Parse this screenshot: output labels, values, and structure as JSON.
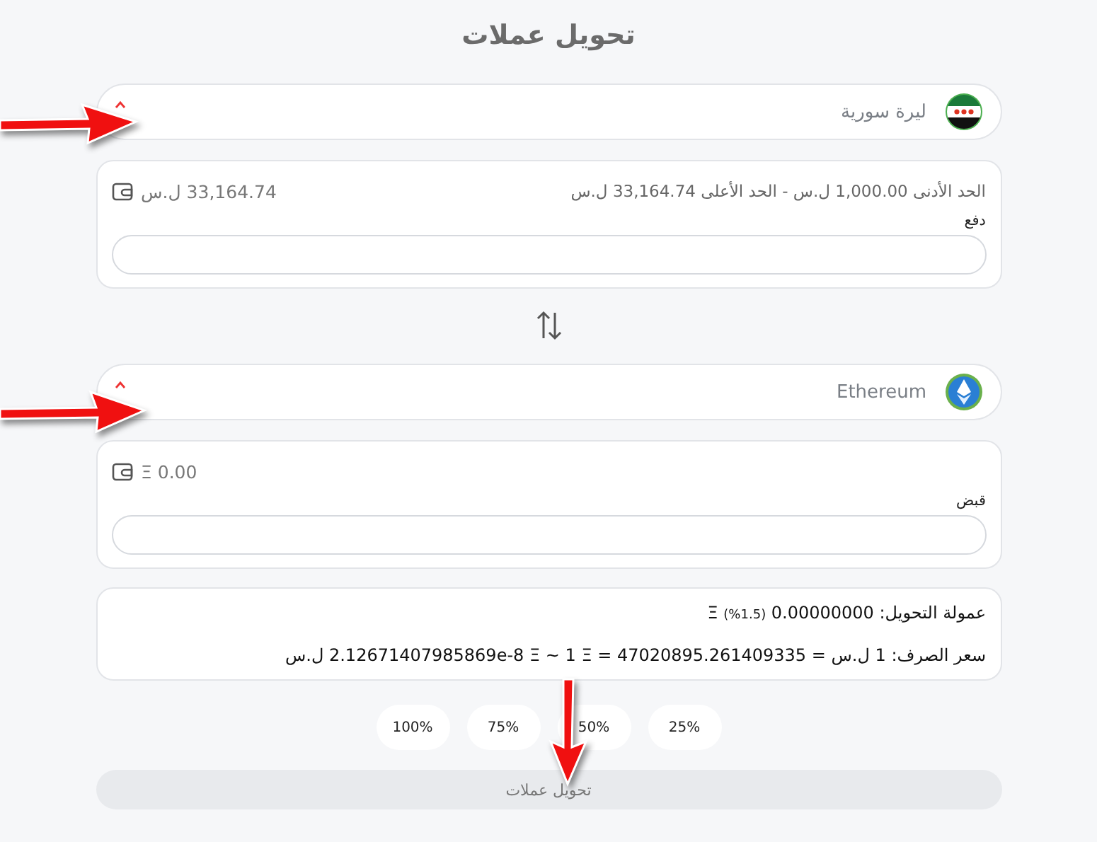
{
  "title": "تحويل عملات",
  "from": {
    "currency": {
      "name": "ليرة سورية",
      "kind": "flag"
    },
    "limits": {
      "min": "الحد الأدنى 1,000.00 ل.س",
      "separator": "-",
      "max": "الحد الأعلى 33,164.74 ل.س"
    },
    "balance": "33,164.74 ل.س",
    "label": "دفع"
  },
  "to": {
    "currency": {
      "name": "Ethereum",
      "kind": "eth"
    },
    "balance": "Ξ 0.00",
    "label": "قبض"
  },
  "fee": {
    "label": "عمولة التحويل:",
    "amount": "0.00000000",
    "percent": "(1.5%)",
    "unit": "Ξ"
  },
  "rate": "سعر الصرف: 1 ل.س = 2.12671407985869e-8 Ξ ~ 1 Ξ = 47020895.261409335 ل.س",
  "percent_buttons": [
    "25%",
    "50%",
    "75%",
    "100%"
  ],
  "submit": {
    "label": "تحويل عملات",
    "disabled": true
  }
}
